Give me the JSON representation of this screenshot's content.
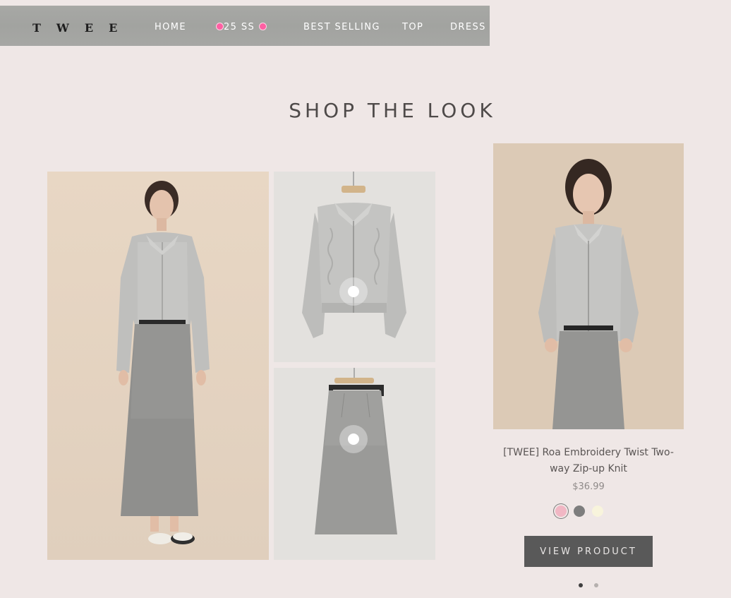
{
  "nav": {
    "logo_letters": [
      "T",
      "W",
      "E",
      "E"
    ],
    "items": [
      {
        "label": "HOME"
      },
      {
        "label": "25 SS"
      },
      {
        "label": "BEST SELLING"
      },
      {
        "label": "TOP"
      },
      {
        "label": "DRESS"
      }
    ]
  },
  "section": {
    "title": "SHOP THE LOOK"
  },
  "product": {
    "name": "[TWEE] Roa Embroidery Twist Two-way Zip-up Knit",
    "price": "$36.99",
    "swatches": [
      {
        "name": "pink",
        "color": "#f1b7c4",
        "selected": true
      },
      {
        "name": "gray",
        "color": "#7d7d7d",
        "selected": false
      },
      {
        "name": "cream",
        "color": "#f8f4dc",
        "selected": false
      }
    ],
    "button_label": "VIEW PRODUCT"
  },
  "carousel": {
    "count": 2,
    "active": 0
  },
  "colors": {
    "background": "#efe7e6",
    "nav_bg": "#a5a6a3",
    "button_bg": "#595959",
    "heart": "#ff5fa2"
  }
}
